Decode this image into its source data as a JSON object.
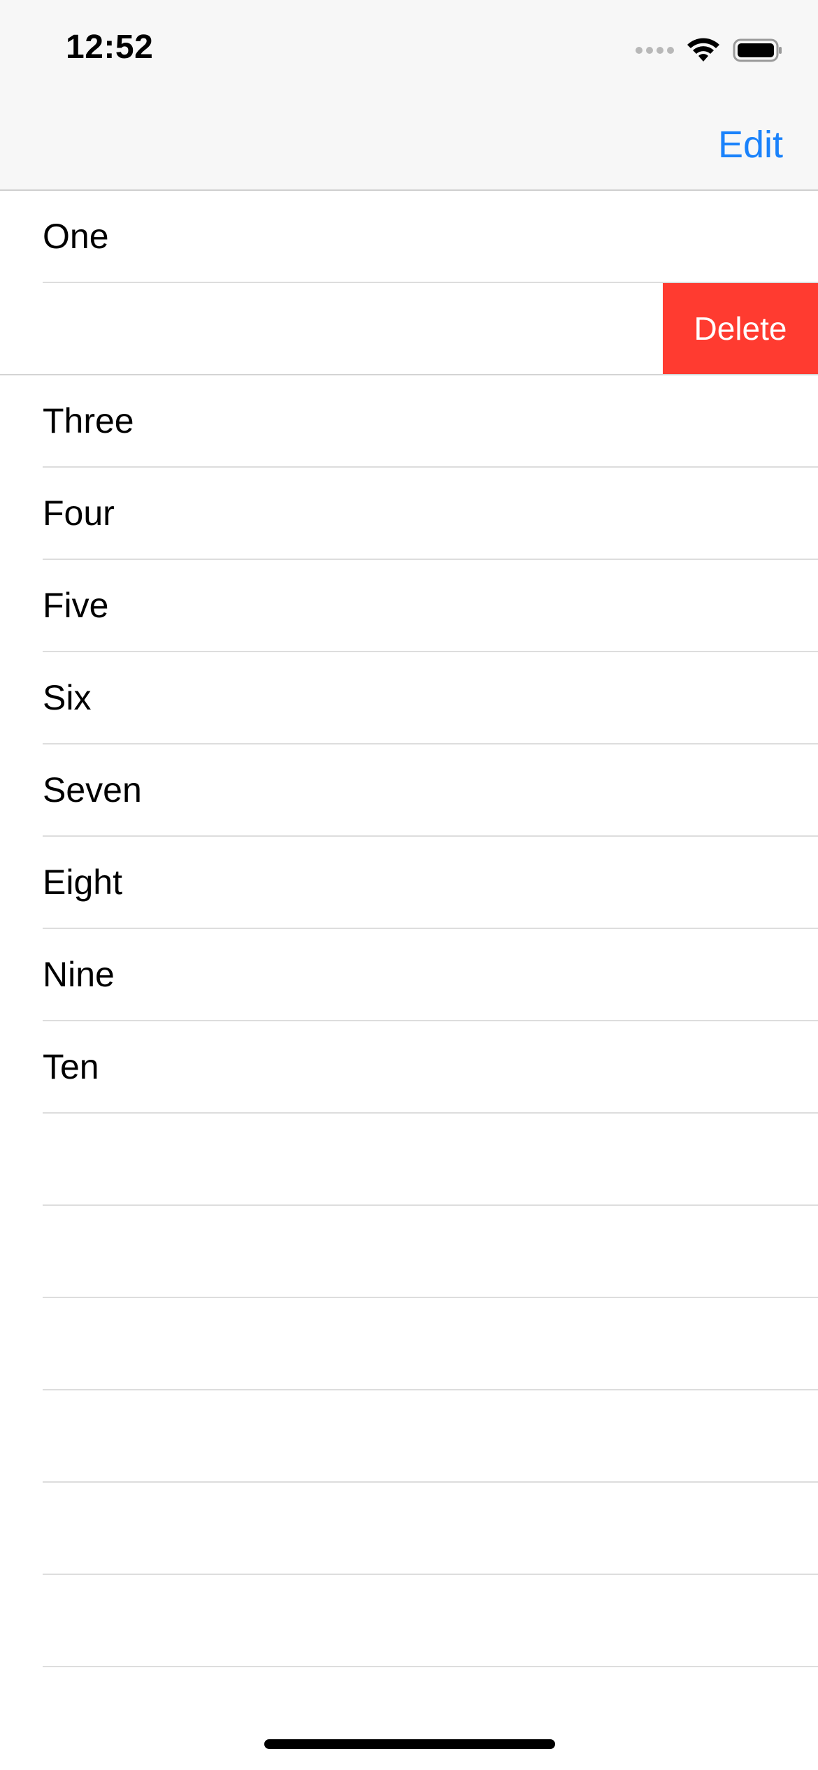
{
  "status_bar": {
    "time": "12:52",
    "icons": [
      "cellular-signal-icon",
      "wifi-icon",
      "battery-icon"
    ]
  },
  "nav_bar": {
    "edit_label": "Edit"
  },
  "list": {
    "rows": [
      {
        "label": "One"
      },
      {
        "label": "",
        "swipe_action": "Delete"
      },
      {
        "label": "Three"
      },
      {
        "label": "Four"
      },
      {
        "label": "Five"
      },
      {
        "label": "Six"
      },
      {
        "label": "Seven"
      },
      {
        "label": "Eight"
      },
      {
        "label": "Nine"
      },
      {
        "label": "Ten"
      }
    ],
    "empty_rows": 6
  },
  "colors": {
    "accent": "#1a82fb",
    "destructive": "#ff3b30",
    "nav_background": "#f7f7f7",
    "separator": "#dddddd"
  }
}
